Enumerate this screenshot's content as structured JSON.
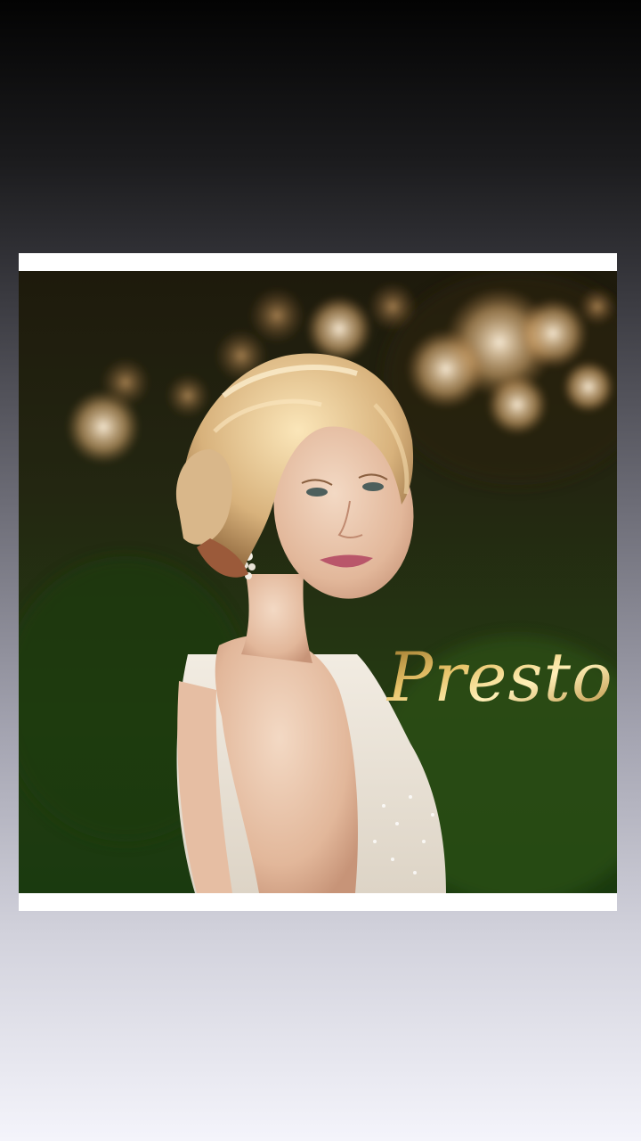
{
  "post": {
    "logo_text": "Presto",
    "accent_gold": "#c9a14a",
    "background_top": "#030303",
    "background_bottom": "#f4f4fb",
    "frame_color": "#ffffff"
  }
}
